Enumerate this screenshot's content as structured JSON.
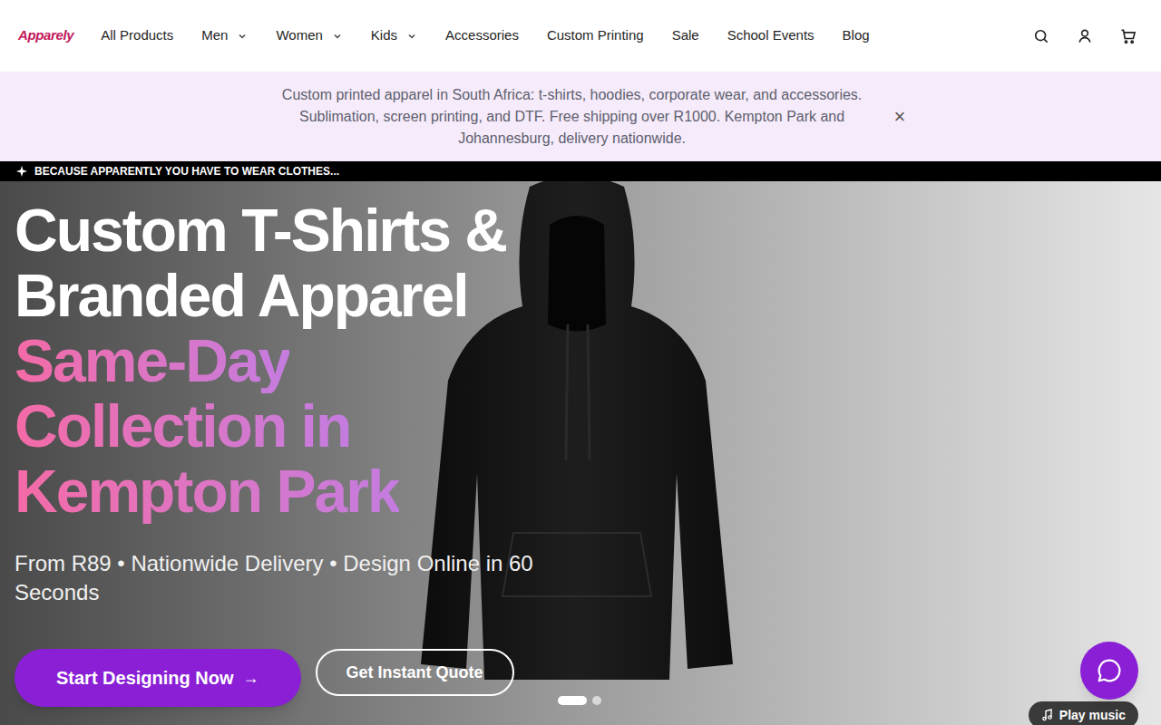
{
  "logo": "Apparely",
  "nav": [
    {
      "label": "All Products",
      "has_menu": false
    },
    {
      "label": "Men",
      "has_menu": true
    },
    {
      "label": "Women",
      "has_menu": true
    },
    {
      "label": "Kids",
      "has_menu": true
    },
    {
      "label": "Accessories",
      "has_menu": false
    },
    {
      "label": "Custom Printing",
      "has_menu": false
    },
    {
      "label": "Sale",
      "has_menu": false
    },
    {
      "label": "School Events",
      "has_menu": false
    },
    {
      "label": "Blog",
      "has_menu": false
    }
  ],
  "banner": {
    "text": "Custom printed apparel in South Africa: t-shirts, hoodies, corporate wear, and accessories. Sublimation, screen printing, and DTF. Free shipping over R1000. Kempton Park and Johannesburg, delivery nationwide.",
    "close": "×"
  },
  "ticker": "BECAUSE APPARENTLY YOU HAVE TO WEAR CLOTHES...",
  "hero": {
    "title_lines": [
      "Custom T-Shirts &",
      "Branded Apparel"
    ],
    "highlight_lines": [
      "Same-Day",
      "Collection in",
      "Kempton Park"
    ],
    "subtitle": "From R89 • Nationwide Delivery • Design Online in 60 Seconds",
    "buttons": [
      {
        "label": "Start Designing Now",
        "arrow": "→",
        "kind": "primary"
      },
      {
        "label": "Get Instant Quote",
        "arrow": "",
        "kind": "outline"
      }
    ],
    "slides": [
      {
        "selected": true
      },
      {
        "selected": false
      }
    ]
  },
  "play_music": "Play music"
}
